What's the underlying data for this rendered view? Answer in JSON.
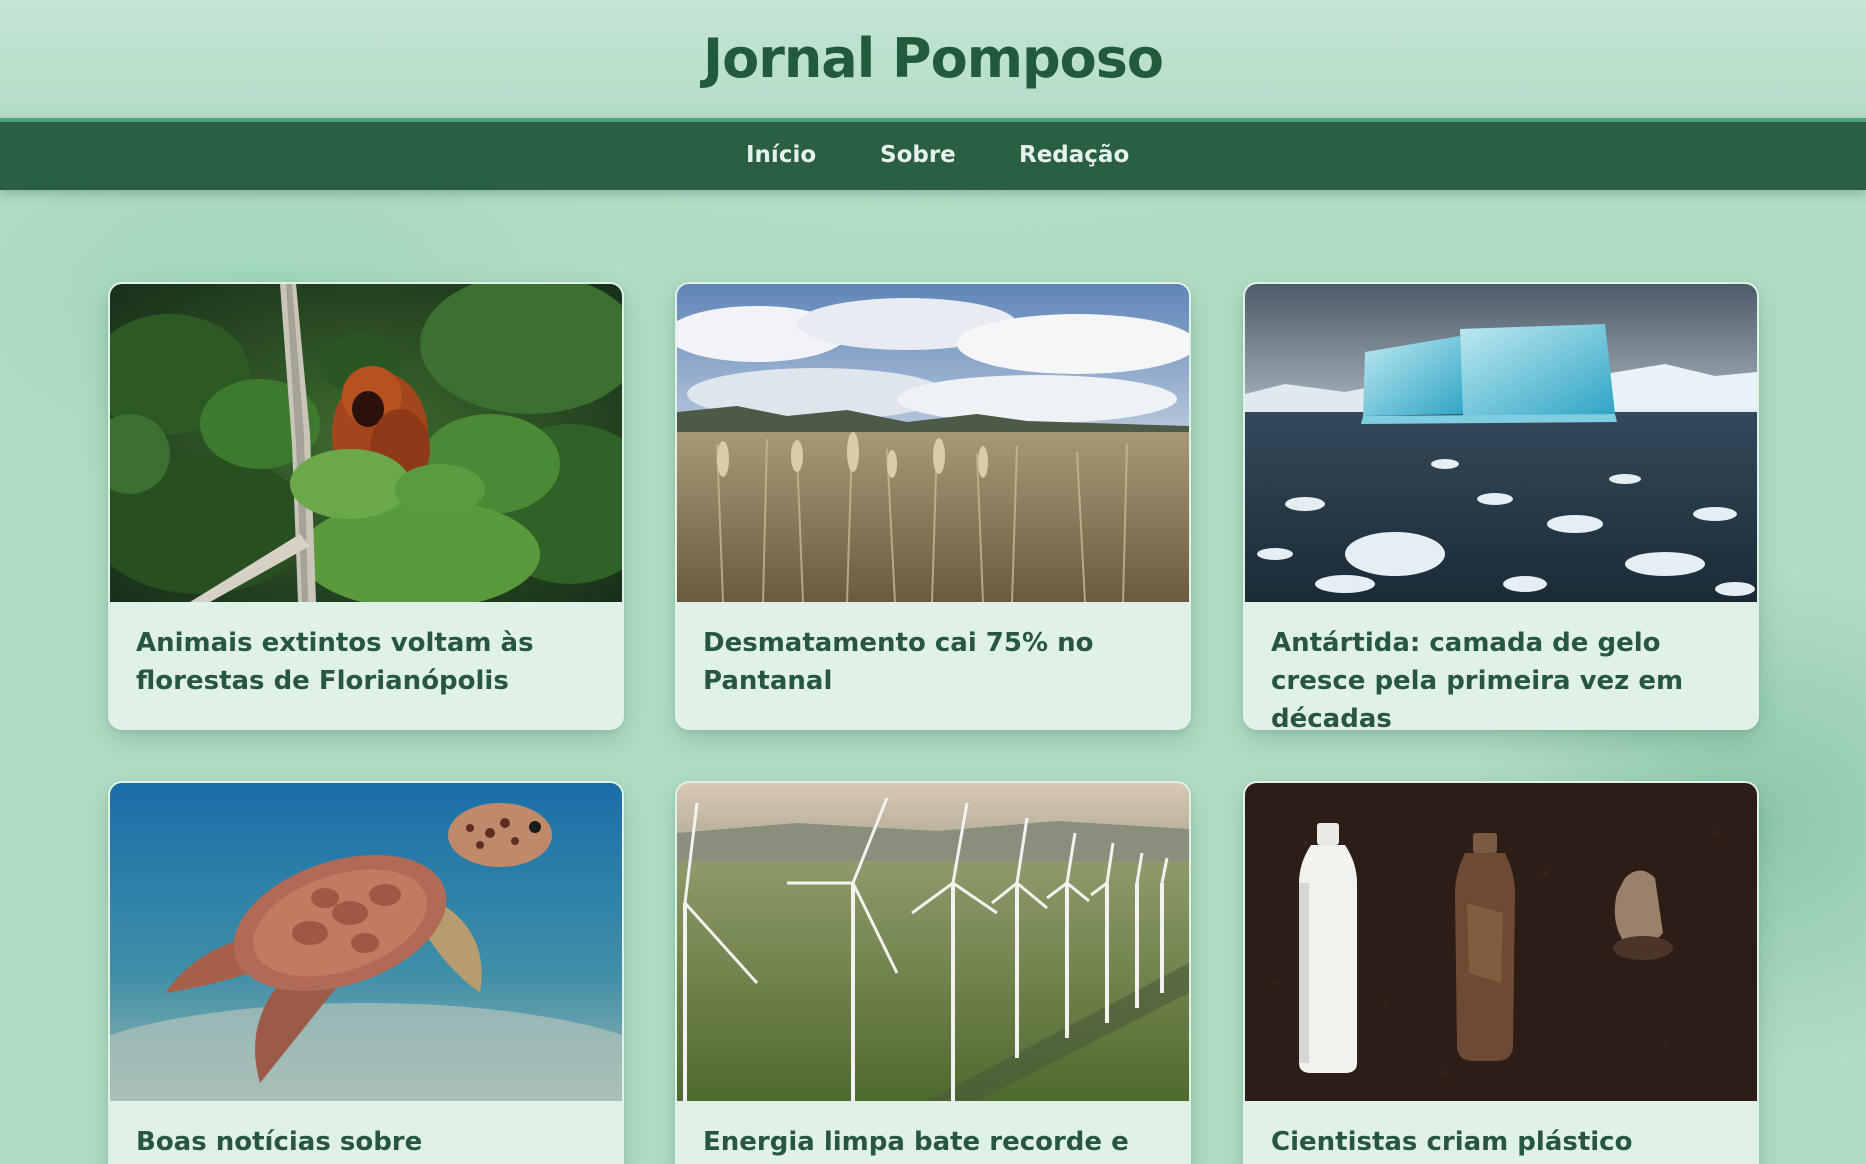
{
  "site": {
    "title": "Jornal Pomposo"
  },
  "nav": {
    "items": [
      {
        "label": "Início"
      },
      {
        "label": "Sobre"
      },
      {
        "label": "Redação"
      }
    ]
  },
  "colors": {
    "background": "#b1dcc5",
    "header": "#c4e6d4",
    "nav": "#2a5f42",
    "nav_accent": "#4ca37a",
    "card": "#e0f1e7",
    "text_dark_green": "#27573f",
    "title_green": "#225a3c"
  },
  "articles": [
    {
      "title": "Animais extintos voltam às florestas de Florianópolis",
      "image": "howler-monkey-forest-photo"
    },
    {
      "title": "Desmatamento cai 75% no Pantanal",
      "image": "pantanal-grassland-photo"
    },
    {
      "title": "Antártida: camada de gelo cresce pela primeira vez em décadas",
      "image": "antarctic-iceberg-photo"
    },
    {
      "title": "Boas notícias sobre preservação de",
      "image": "sea-turtle-photo"
    },
    {
      "title": "Energia limpa bate recorde e",
      "image": "wind-farm-photo"
    },
    {
      "title": "Cientistas criam plástico reciclável",
      "image": "biodegradable-bottle-photo"
    }
  ]
}
